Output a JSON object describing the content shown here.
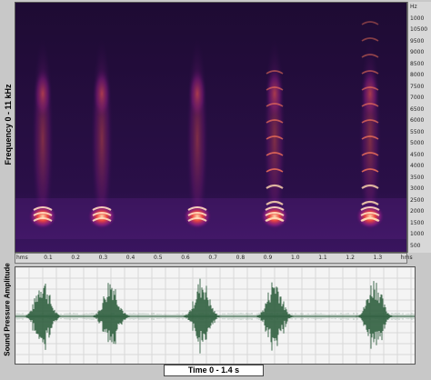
{
  "spectrogram": {
    "ylabel": "Frequency 0 - 11 kHz",
    "freq_labels": [
      "Hz",
      "1000",
      "10500",
      "9500",
      "9000",
      "8500",
      "8000",
      "7500",
      "7000",
      "6500",
      "6000",
      "5500",
      "5000",
      "4500",
      "4000",
      "3500",
      "3000",
      "2500",
      "2000",
      "1500",
      "1000",
      "500"
    ],
    "time_labels": [
      "hms",
      "0.1",
      "0.2",
      "0.3",
      "0.4",
      "0.5",
      "0.6",
      "0.7",
      "0.8",
      "0.9",
      "1.0",
      "1.1",
      "1.2",
      "1.3",
      "hms"
    ]
  },
  "waveform": {
    "ylabel": "Sound Pressure Amplitude"
  },
  "xlabel": "Time 0 - 1.4 s",
  "colors": {
    "spec_bg": "#1a0a2e",
    "hot": "#ffd0a0",
    "wave": "#2f5f3f"
  }
}
